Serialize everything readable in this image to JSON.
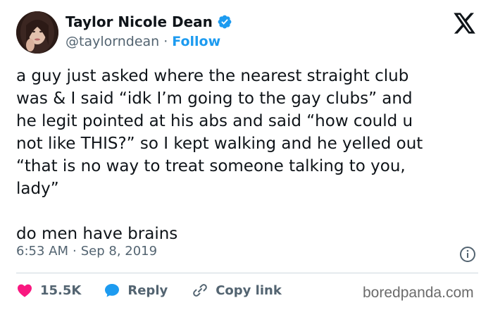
{
  "author": {
    "display_name": "Taylor Nicole Dean",
    "handle": "@taylorndean",
    "separator": "·",
    "follow_label": "Follow",
    "verified": true
  },
  "platform_logo": "x-logo-icon",
  "tweet": {
    "text": "a guy just asked where the nearest straight club\nwas & I said “idk I’m going to the gay clubs” and\nhe legit pointed at his abs and said “how could u\nnot like THIS?” so I kept walking and he yelled out\n“that is no way to treat someone talking to you,\nlady”\n\ndo men have brains"
  },
  "meta": {
    "time": "6:53 AM",
    "separator": "·",
    "date": "Sep 8, 2019"
  },
  "actions": {
    "like_count": "15.5K",
    "reply_label": "Reply",
    "copy_link_label": "Copy link"
  },
  "watermark": "boredpanda.com",
  "colors": {
    "accent": "#1d9bf0",
    "like": "#f91880",
    "text": "#0f1419",
    "muted": "#536471"
  }
}
